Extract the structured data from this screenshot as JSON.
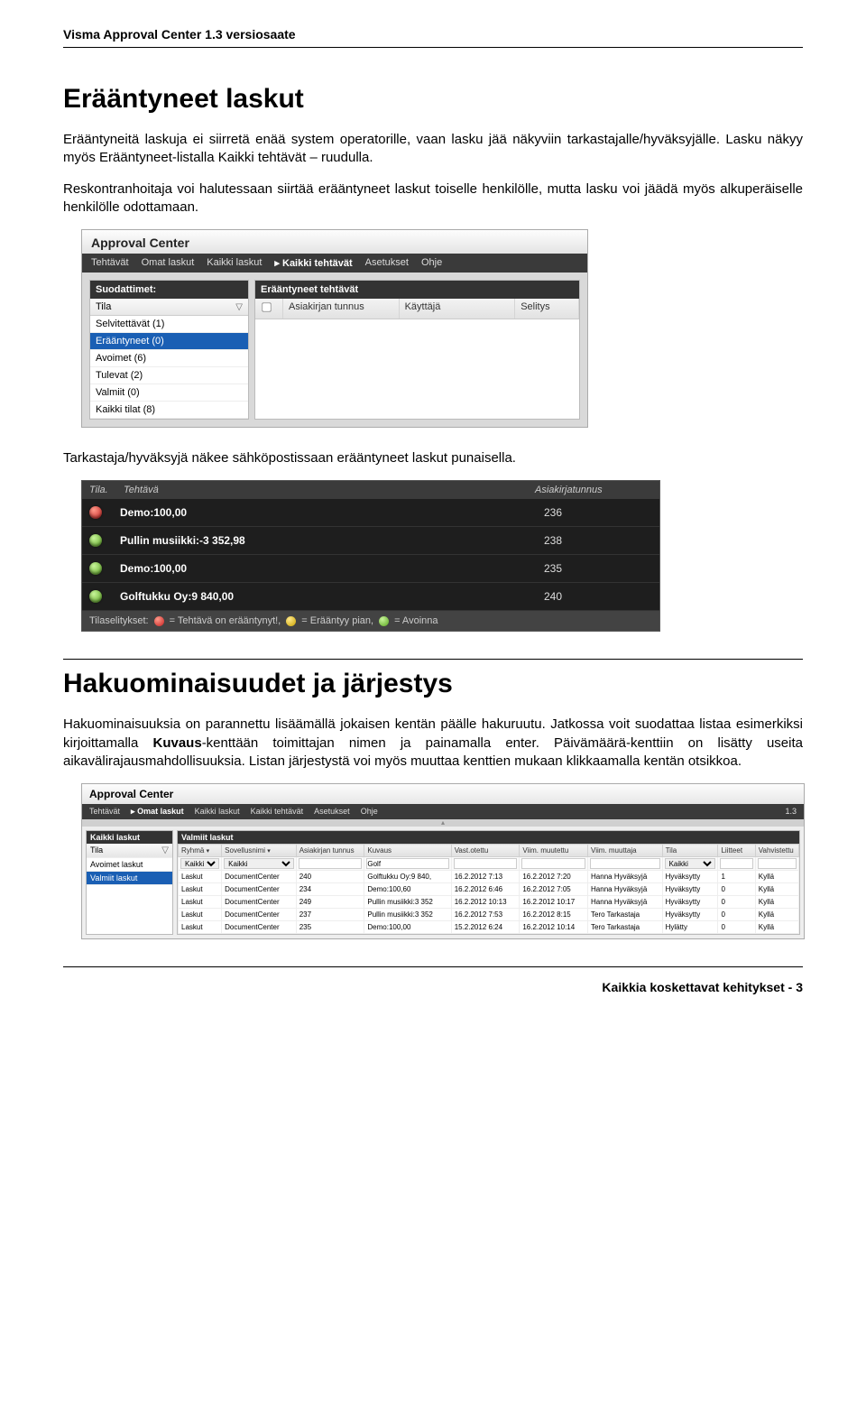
{
  "header": "Visma Approval Center 1.3 versiosaate",
  "section1": {
    "title": "Erääntyneet laskut",
    "p1": "Erääntyneitä laskuja ei siirretä enää system operatorille, vaan lasku jää näkyviin tarkastajalle/hyväksyjälle. Lasku näkyy myös Erääntyneet-listalla Kaikki tehtävät – ruudulla.",
    "p2": "Reskontranhoitaja voi halutessaan siirtää erääntyneet laskut toiselle henkilölle, mutta lasku voi jäädä myös alkuperäiselle henkilölle odottamaan.",
    "p3": "Tarkastaja/hyväksyjä näkee sähköpostissaan erääntyneet laskut punaisella."
  },
  "app1": {
    "title": "Approval Center",
    "menu": [
      "Tehtävät",
      "Omat laskut",
      "Kaikki laskut",
      "Kaikki tehtävät",
      "Asetukset",
      "Ohje"
    ],
    "menu_selected": 3,
    "sidebar_title": "Suodattimet:",
    "tila_label": "Tila",
    "items": [
      "Selvitettävät (1)",
      "Erääntyneet (0)",
      "Avoimet (6)",
      "Tulevat (2)",
      "Valmiit (0)",
      "Kaikki tilat (8)"
    ],
    "selected_item": 1,
    "main_title": "Erääntyneet tehtävät",
    "cols": [
      "Asiakirjan tunnus",
      "Käyttäjä",
      "Selitys"
    ]
  },
  "email": {
    "cols": [
      "Tila.",
      "Tehtävä",
      "Asiakirjatunnus"
    ],
    "rows": [
      {
        "color": "red",
        "task": "Demo:100,00",
        "id": "236"
      },
      {
        "color": "green",
        "task": "Pullin musiikki:-3 352,98",
        "id": "238"
      },
      {
        "color": "green",
        "task": "Demo:100,00",
        "id": "235"
      },
      {
        "color": "green",
        "task": "Golftukku Oy:9 840,00",
        "id": "240"
      }
    ],
    "legend_label": "Tilaselitykset:",
    "legend": [
      {
        "color": "red",
        "text": "= Tehtävä on erääntynyt!,"
      },
      {
        "color": "yellow",
        "text": "= Erääntyy pian,"
      },
      {
        "color": "green",
        "text": "= Avoinna"
      }
    ]
  },
  "section2": {
    "title": "Hakuominaisuudet ja järjestys",
    "p1a": "Hakuominaisuuksia on parannettu lisäämällä jokaisen kentän päälle hakuruutu. Jatkossa voit suodattaa listaa esimerkiksi kirjoittamalla ",
    "p1b_bold": "Kuvaus",
    "p1c": "-kenttään toimittajan nimen ja painamalla enter. Päivämäärä-kenttiin on lisätty useita aikavälirajausmahdollisuuksia. Listan järjestystä voi myös muuttaa kenttien mukaan klikkaamalla kentän otsikkoa."
  },
  "app3": {
    "title": "Approval Center",
    "menu": [
      "Tehtävät",
      "Omat laskut",
      "Kaikki laskut",
      "Kaikki tehtävät",
      "Asetukset",
      "Ohje"
    ],
    "menu_selected": 1,
    "version": "1.3",
    "side_title": "Kaikki laskut",
    "tila_label": "Tila",
    "side_items": [
      "Avoimet laskut",
      "Valmiit laskut"
    ],
    "side_selected": 1,
    "main_title": "Valmiit laskut",
    "cols": [
      "Ryhmä",
      "Sovellusnimi",
      "Asiakirjan tunnus",
      "Kuvaus",
      "Vast.otettu",
      "Viim. muutettu",
      "Viim. muuttaja",
      "Tila",
      "Liitteet",
      "Vahvistettu"
    ],
    "filter": [
      "Kaikki",
      "Kaikki",
      "",
      "Golf",
      "",
      "",
      "",
      "Kaikki",
      "",
      ""
    ],
    "rows": [
      [
        "Laskut",
        "DocumentCenter",
        "240",
        "Golftukku Oy:9 840,",
        "16.2.2012 7:13",
        "16.2.2012 7:20",
        "Hanna Hyväksyjä",
        "Hyväksytty",
        "1",
        "Kyllä"
      ],
      [
        "Laskut",
        "DocumentCenter",
        "234",
        "Demo:100,60",
        "16.2.2012 6:46",
        "16.2.2012 7:05",
        "Hanna Hyväksyjä",
        "Hyväksytty",
        "0",
        "Kyllä"
      ],
      [
        "Laskut",
        "DocumentCenter",
        "249",
        "Pullin musiikki:3 352",
        "16.2.2012 10:13",
        "16.2.2012 10:17",
        "Hanna Hyväksyjä",
        "Hyväksytty",
        "0",
        "Kyllä"
      ],
      [
        "Laskut",
        "DocumentCenter",
        "237",
        "Pullin musiikki:3 352",
        "16.2.2012 7:53",
        "16.2.2012 8:15",
        "Tero Tarkastaja",
        "Hyväksytty",
        "0",
        "Kyllä"
      ],
      [
        "Laskut",
        "DocumentCenter",
        "235",
        "Demo:100,00",
        "15.2.2012 6:24",
        "16.2.2012 10:14",
        "Tero Tarkastaja",
        "Hylätty",
        "0",
        "Kyllä"
      ]
    ]
  },
  "footer": "Kaikkia koskettavat kehitykset - 3"
}
